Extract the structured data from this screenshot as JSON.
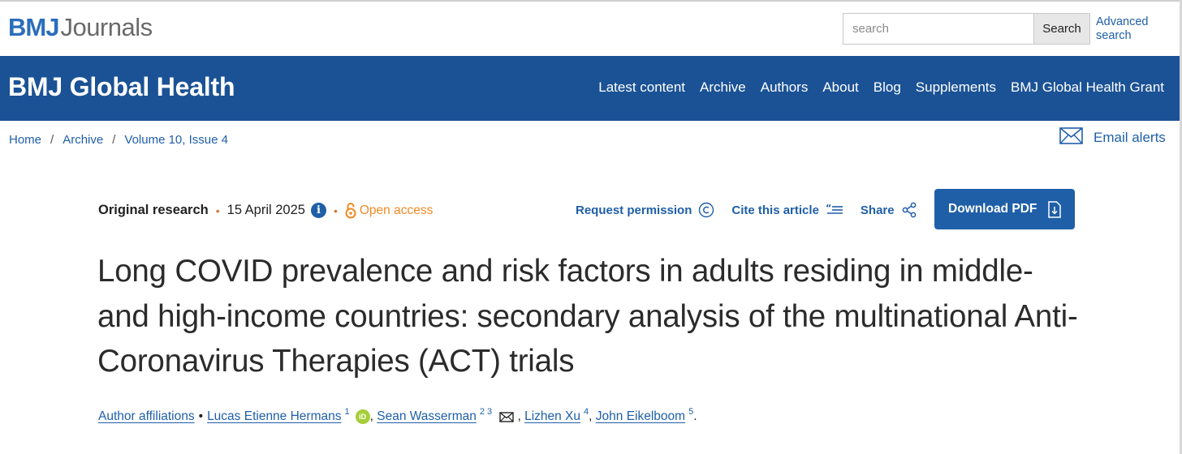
{
  "brand": {
    "logo_bmj": "BMJ",
    "logo_journals": "Journals"
  },
  "search": {
    "placeholder": "search",
    "button_label": "Search",
    "advanced_label": "Advanced search"
  },
  "header": {
    "site_title": "BMJ Global Health",
    "nav": [
      "Latest content",
      "Archive",
      "Authors",
      "About",
      "Blog",
      "Supplements",
      "BMJ Global Health Grant"
    ]
  },
  "breadcrumb": [
    "Home",
    "Archive",
    "Volume 10, Issue 4"
  ],
  "email_alerts": {
    "label": "Email alerts",
    "icon": "envelope-icon"
  },
  "article_meta": {
    "type": "Original research",
    "date": "15 April 2025",
    "access": "Open access",
    "access_color": "#f08a24"
  },
  "actions": {
    "request_permission": "Request permission",
    "cite": "Cite this article",
    "share": "Share",
    "download": "Download PDF"
  },
  "article": {
    "title": "Long COVID prevalence and risk factors in adults residing in middle- and high-income countries: secondary analysis of the multinational Anti-Coronavirus Therapies (ACT) trials"
  },
  "authors": {
    "affiliations_label": "Author affiliations",
    "list": [
      {
        "name": "Lucas Etienne Hermans",
        "sup": "1"
      },
      {
        "name": "Sean Wasserman",
        "sup": "2 3"
      },
      {
        "name": "Lizhen Xu",
        "sup": "4"
      },
      {
        "name": "John Eikelboom",
        "sup": "5"
      }
    ]
  },
  "colors": {
    "brand_blue": "#1b5295",
    "link_blue": "#1f5fa8",
    "orcid_green": "#a6ce39"
  }
}
